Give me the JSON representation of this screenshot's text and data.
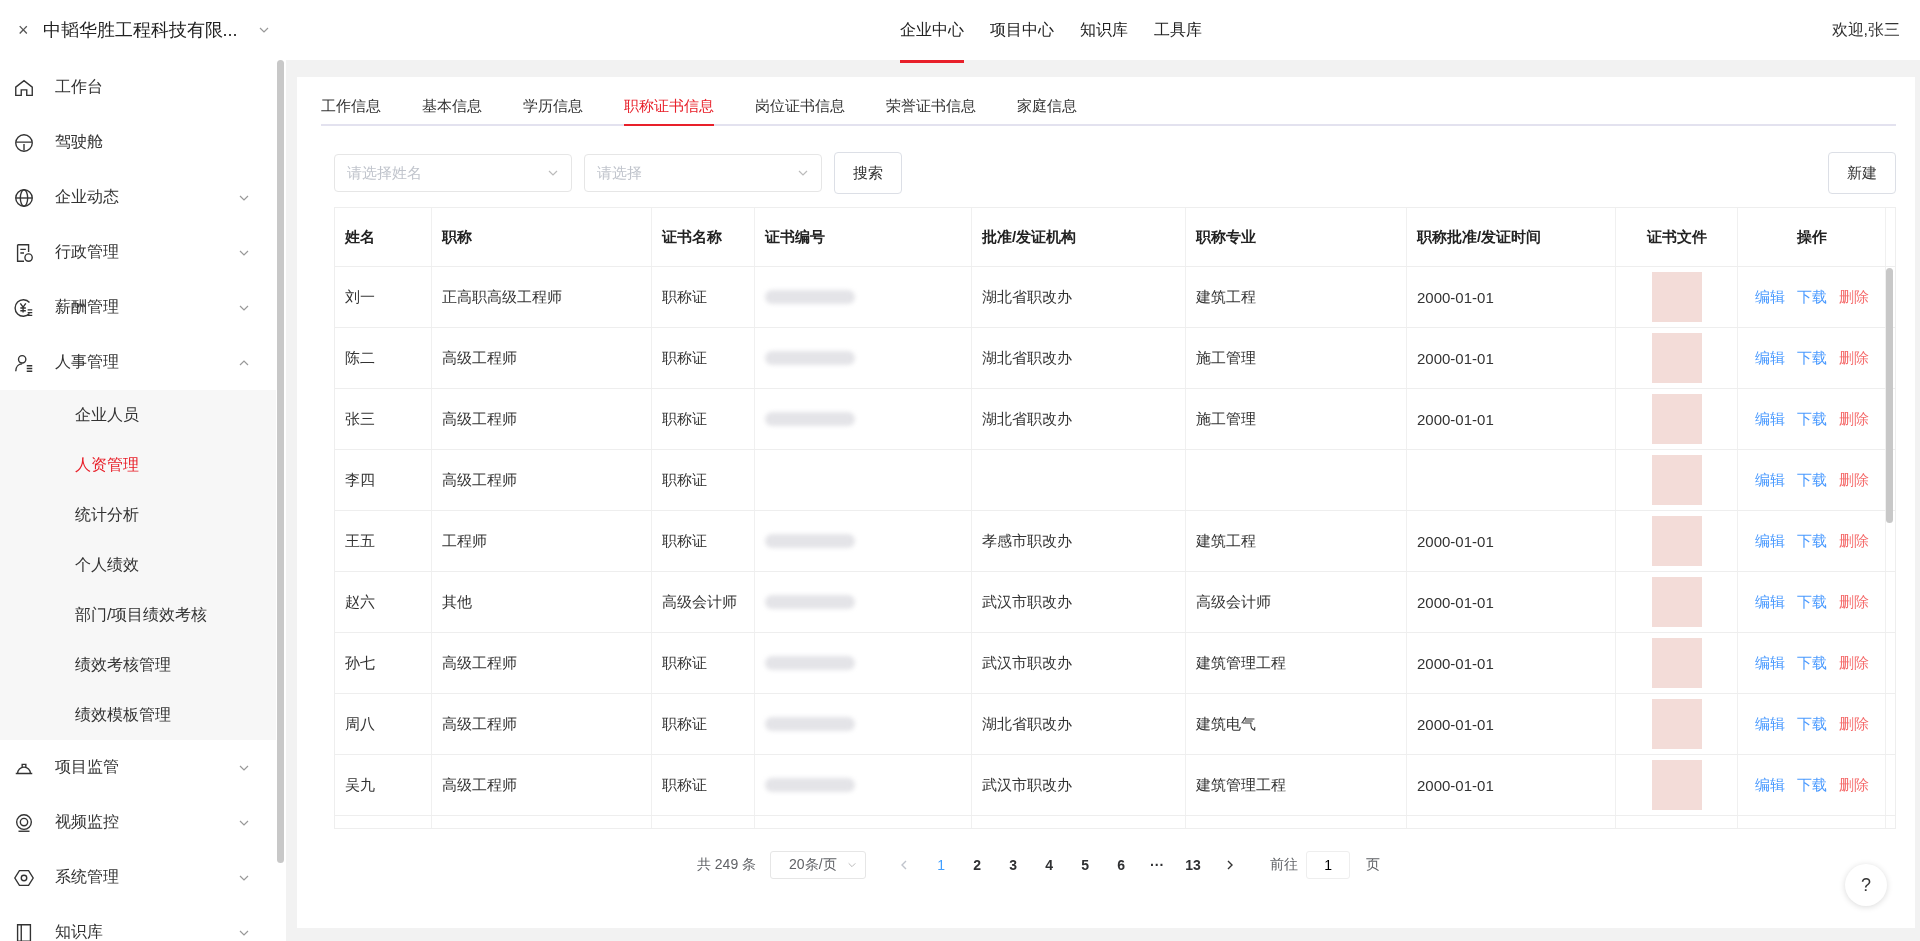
{
  "header": {
    "close": "×",
    "company": "中韬华胜工程科技有限...",
    "nav": [
      {
        "label": "企业中心",
        "selected": true
      },
      {
        "label": "项目中心",
        "selected": false
      },
      {
        "label": "知识库",
        "selected": false
      },
      {
        "label": "工具库",
        "selected": false
      }
    ],
    "welcome": "欢迎,张三"
  },
  "sidebar": {
    "items": [
      {
        "label": "工作台",
        "kind": "link"
      },
      {
        "label": "驾驶舱",
        "kind": "link"
      },
      {
        "label": "企业动态",
        "kind": "group",
        "expanded": false
      },
      {
        "label": "行政管理",
        "kind": "group",
        "expanded": false
      },
      {
        "label": "薪酬管理",
        "kind": "group",
        "expanded": false
      },
      {
        "label": "人事管理",
        "kind": "group",
        "expanded": true,
        "children": [
          {
            "label": "企业人员",
            "selected": false
          },
          {
            "label": "人资管理",
            "selected": true
          },
          {
            "label": "统计分析",
            "selected": false
          },
          {
            "label": "个人绩效",
            "selected": false
          },
          {
            "label": "部门/项目绩效考核",
            "selected": false
          },
          {
            "label": "绩效考核管理",
            "selected": false
          },
          {
            "label": "绩效模板管理",
            "selected": false
          }
        ]
      },
      {
        "label": "项目监管",
        "kind": "group",
        "expanded": false
      },
      {
        "label": "视频监控",
        "kind": "group",
        "expanded": false
      },
      {
        "label": "系统管理",
        "kind": "group",
        "expanded": false
      },
      {
        "label": "知识库",
        "kind": "group",
        "expanded": false
      }
    ]
  },
  "tabs": [
    {
      "label": "工作信息",
      "selected": false
    },
    {
      "label": "基本信息",
      "selected": false
    },
    {
      "label": "学历信息",
      "selected": false
    },
    {
      "label": "职称证书信息",
      "selected": true
    },
    {
      "label": "岗位证书信息",
      "selected": false
    },
    {
      "label": "荣誉证书信息",
      "selected": false
    },
    {
      "label": "家庭信息",
      "selected": false
    }
  ],
  "filters": {
    "name": {
      "placeholder": "请选择姓名"
    },
    "type": {
      "placeholder": "请选择"
    },
    "search": "搜索",
    "create": "新建"
  },
  "table": {
    "columns": [
      "姓名",
      "职称",
      "证书名称",
      "证书编号",
      "批准/发证机构",
      "职称专业",
      "职称批准/发证时间",
      "证书文件",
      "操作"
    ],
    "rows": [
      {
        "name": "刘一",
        "title": "正高职高级工程师",
        "cert": "职称证",
        "number_blurred": true,
        "org": "湖北省职改办",
        "major": "建筑工程",
        "date": "2000-01-01",
        "actions": [
          {
            "label": "编辑",
            "kind": "link"
          },
          {
            "label": "下载",
            "kind": "link"
          },
          {
            "label": "删除",
            "kind": "danger"
          }
        ]
      },
      {
        "name": "陈二",
        "title": "高级工程师",
        "cert": "职称证",
        "number_blurred": true,
        "org": "湖北省职改办",
        "major": "施工管理",
        "date": "2000-01-01",
        "actions": [
          {
            "label": "编辑",
            "kind": "link"
          },
          {
            "label": "下载",
            "kind": "link"
          },
          {
            "label": "删除",
            "kind": "danger"
          }
        ]
      },
      {
        "name": "张三",
        "title": "高级工程师",
        "cert": "职称证",
        "number_blurred": true,
        "org": "湖北省职改办",
        "major": "施工管理",
        "date": "2000-01-01",
        "actions": [
          {
            "label": "编辑",
            "kind": "link"
          },
          {
            "label": "下载",
            "kind": "link"
          },
          {
            "label": "删除",
            "kind": "danger"
          }
        ]
      },
      {
        "name": "李四",
        "title": "高级工程师",
        "cert": "职称证",
        "number_blurred": false,
        "actions": [
          {
            "label": "编辑",
            "kind": "link"
          },
          {
            "label": "下载",
            "kind": "link"
          },
          {
            "label": "删除",
            "kind": "danger"
          }
        ]
      },
      {
        "name": "王五",
        "title": "工程师",
        "cert": "职称证",
        "number_blurred": true,
        "org": "孝感市职改办",
        "major": "建筑工程",
        "date": "2000-01-01",
        "actions": [
          {
            "label": "编辑",
            "kind": "link"
          },
          {
            "label": "下载",
            "kind": "link"
          },
          {
            "label": "删除",
            "kind": "danger"
          }
        ]
      },
      {
        "name": "赵六",
        "title": "其他",
        "cert": "高级会计师",
        "number_blurred": true,
        "org": "武汉市职改办",
        "major": "高级会计师",
        "date": "2000-01-01",
        "actions": [
          {
            "label": "编辑",
            "kind": "link"
          },
          {
            "label": "下载",
            "kind": "link"
          },
          {
            "label": "删除",
            "kind": "danger"
          }
        ]
      },
      {
        "name": "孙七",
        "title": "高级工程师",
        "cert": "职称证",
        "number_blurred": true,
        "org": "武汉市职改办",
        "major": "建筑管理工程",
        "date": "2000-01-01",
        "actions": [
          {
            "label": "编辑",
            "kind": "link"
          },
          {
            "label": "下载",
            "kind": "link"
          },
          {
            "label": "删除",
            "kind": "danger"
          }
        ]
      },
      {
        "name": "周八",
        "title": "高级工程师",
        "cert": "职称证",
        "number_blurred": true,
        "org": "湖北省职改办",
        "major": "建筑电气",
        "date": "2000-01-01",
        "actions": [
          {
            "label": "编辑",
            "kind": "link"
          },
          {
            "label": "下载",
            "kind": "link"
          },
          {
            "label": "删除",
            "kind": "danger"
          }
        ]
      },
      {
        "name": "吴九",
        "title": "高级工程师",
        "cert": "职称证",
        "number_blurred": true,
        "org": "武汉市职改办",
        "major": "建筑管理工程",
        "date": "2000-01-01",
        "actions": [
          {
            "label": "编辑",
            "kind": "link"
          },
          {
            "label": "下载",
            "kind": "link"
          },
          {
            "label": "删除",
            "kind": "danger"
          }
        ]
      }
    ]
  },
  "pagination": {
    "total": "共 249 条",
    "page_size": "20条/页",
    "prev_disabled": true,
    "pages": [
      {
        "label": "1",
        "selected": true
      },
      {
        "label": "2",
        "selected": false
      },
      {
        "label": "3",
        "selected": false
      },
      {
        "label": "4",
        "selected": false
      },
      {
        "label": "5",
        "selected": false
      },
      {
        "label": "6",
        "selected": false
      },
      {
        "label": "···",
        "selected": false
      },
      {
        "label": "13",
        "selected": false
      }
    ],
    "goto_label": "前往",
    "goto_value": "1",
    "goto_unit": "页"
  },
  "help": "?"
}
